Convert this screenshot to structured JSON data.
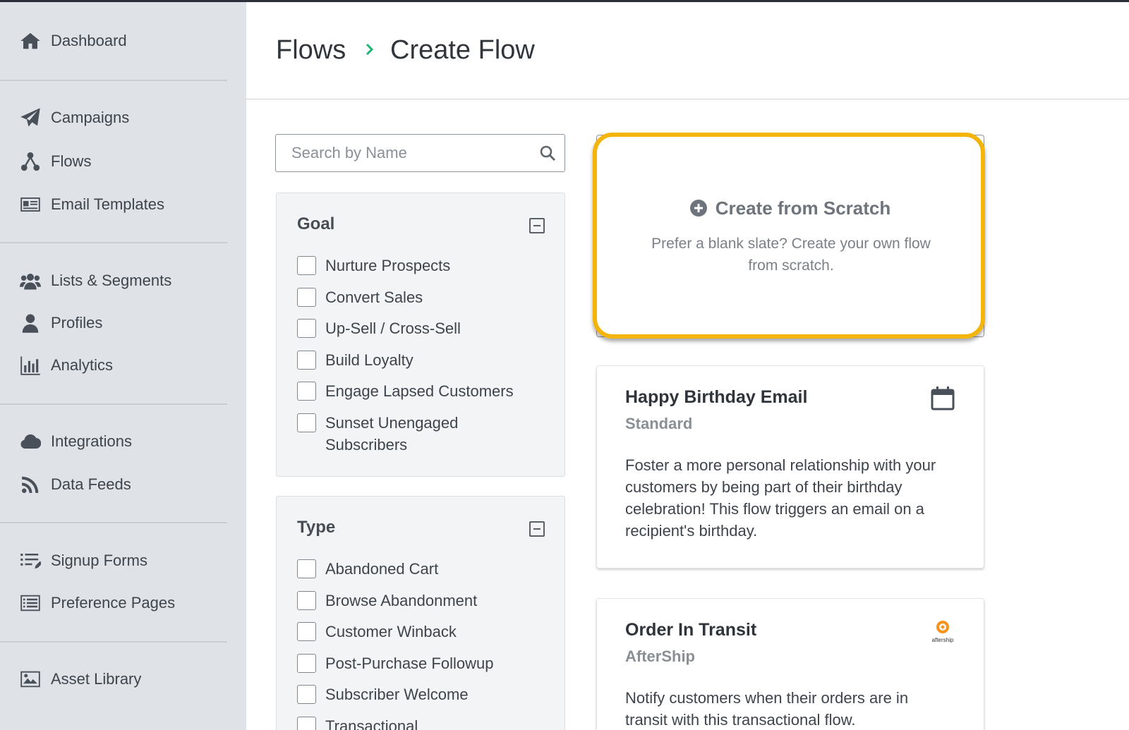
{
  "sidebar": {
    "items": [
      {
        "label": "Dashboard",
        "icon": "home-icon"
      },
      {
        "label": "Campaigns",
        "icon": "paper-plane-icon"
      },
      {
        "label": "Flows",
        "icon": "flow-icon"
      },
      {
        "label": "Email Templates",
        "icon": "newspaper-icon"
      },
      {
        "label": "Lists & Segments",
        "icon": "users-icon"
      },
      {
        "label": "Profiles",
        "icon": "user-icon"
      },
      {
        "label": "Analytics",
        "icon": "bar-chart-icon"
      },
      {
        "label": "Integrations",
        "icon": "cloud-icon"
      },
      {
        "label": "Data Feeds",
        "icon": "rss-icon"
      },
      {
        "label": "Signup Forms",
        "icon": "list-edit-icon"
      },
      {
        "label": "Preference Pages",
        "icon": "list-box-icon"
      },
      {
        "label": "Asset Library",
        "icon": "image-icon"
      }
    ]
  },
  "header": {
    "breadcrumb_root": "Flows",
    "breadcrumb_current": "Create Flow",
    "separator_color": "#1fb574"
  },
  "search": {
    "placeholder": "Search by Name",
    "value": ""
  },
  "filters": {
    "goal": {
      "title": "Goal",
      "options": [
        "Nurture Prospects",
        "Convert Sales",
        "Up-Sell / Cross-Sell",
        "Build Loyalty",
        "Engage Lapsed Customers",
        "Sunset Unengaged Subscribers"
      ]
    },
    "type": {
      "title": "Type",
      "options": [
        "Abandoned Cart",
        "Browse Abandonment",
        "Customer Winback",
        "Post-Purchase Followup",
        "Subscriber Welcome",
        "Transactional"
      ]
    }
  },
  "scratch": {
    "title": "Create from Scratch",
    "description": "Prefer a blank slate? Create your own flow from scratch.",
    "highlight_color": "#f3b40b"
  },
  "cards": [
    {
      "title": "Happy Birthday Email",
      "subtitle": "Standard",
      "description": "Foster a more personal relationship with your customers by being part of their birthday celebration! This flow triggers an email on a recipient's birthday.",
      "icon": "calendar-icon"
    },
    {
      "title": "Order In Transit",
      "subtitle": "AfterShip",
      "description": "Notify customers when their orders are in transit with this transactional flow.",
      "logo_text": "aftership",
      "logo_color": "#f7941d"
    }
  ]
}
